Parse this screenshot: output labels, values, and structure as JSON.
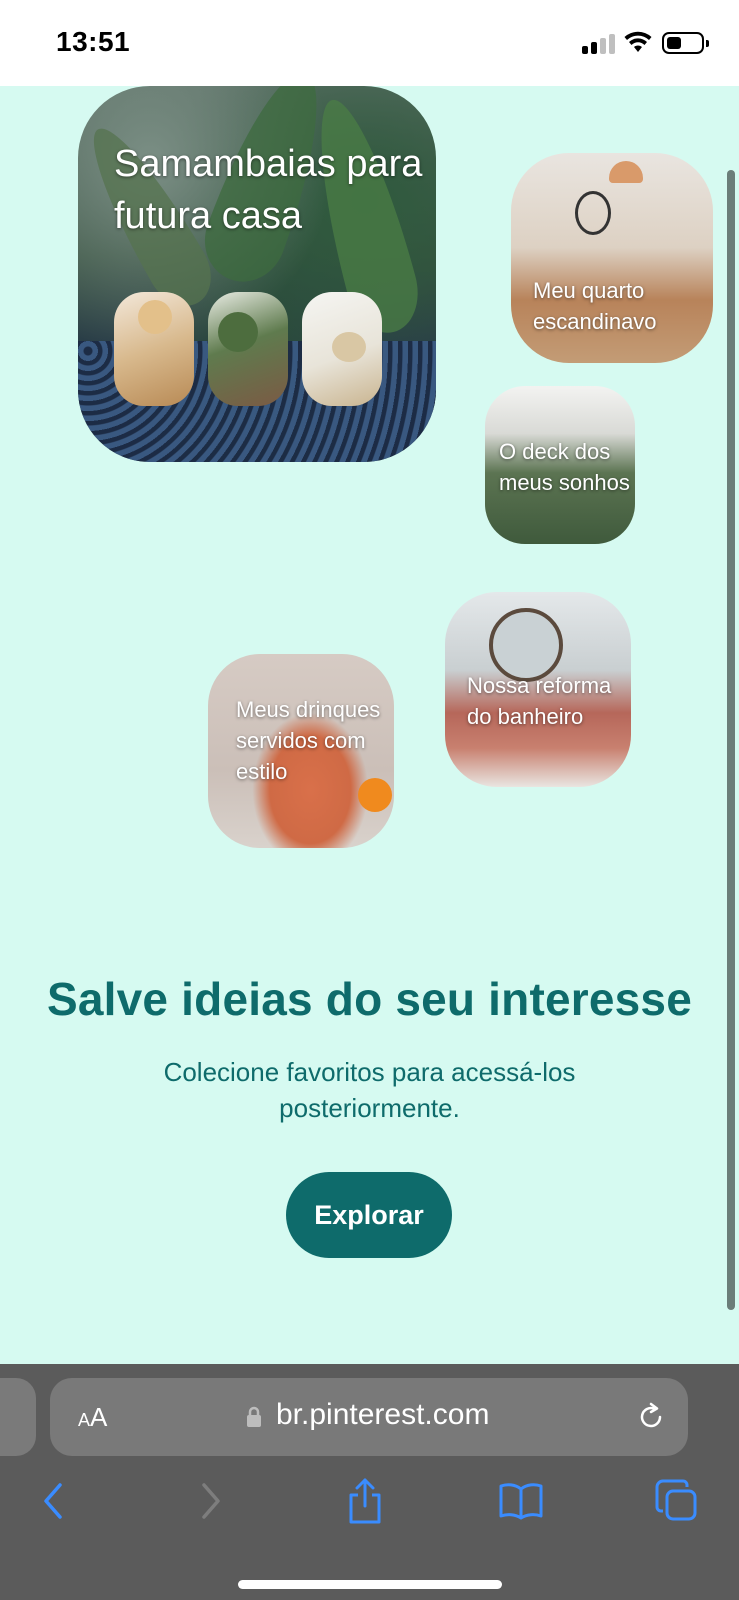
{
  "status_bar": {
    "time": "13:51"
  },
  "boards": [
    {
      "label": "Samambaias para futura casa"
    },
    {
      "label": "Meu quarto escandinavo"
    },
    {
      "label": "O deck dos meus sonhos"
    },
    {
      "label": "Nossa reforma do banheiro"
    },
    {
      "label": "Meus drinques servidos com estilo"
    }
  ],
  "promo": {
    "headline": "Salve ideias do seu interesse",
    "subtext": "Colecione favoritos para acessá-los posteriormente.",
    "button_label": "Explorar"
  },
  "browser": {
    "text_size_label": "AA",
    "url": "br.pinterest.com",
    "icons": [
      "lock-icon",
      "reload-icon",
      "back-icon",
      "forward-icon",
      "share-icon",
      "bookmarks-icon",
      "tabs-icon"
    ]
  },
  "colors": {
    "background": "#d6faf1",
    "accent": "#0e6b6b",
    "toolbar": "#5b5b5b",
    "ios_blue": "#3a8cff"
  }
}
